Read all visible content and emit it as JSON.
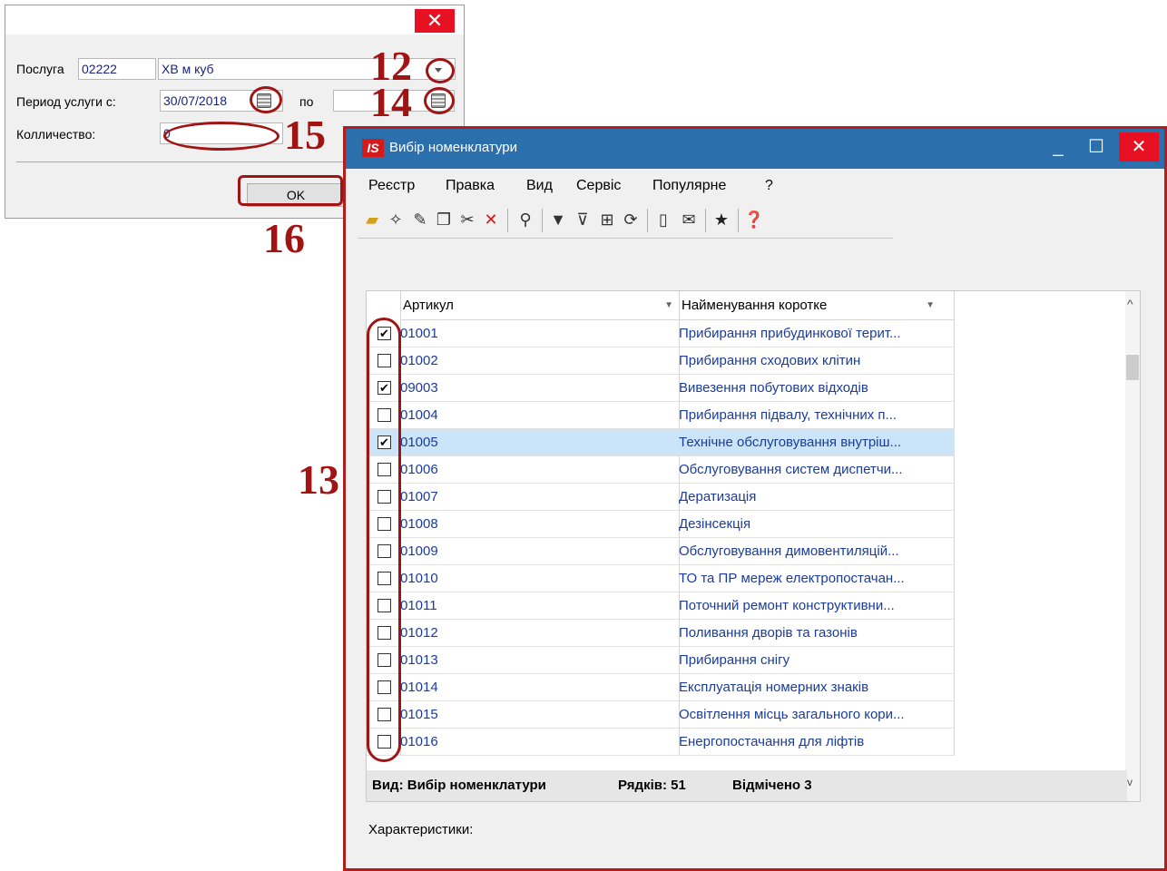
{
  "dialog": {
    "close_glyph": "✕",
    "service_label": "Послуга",
    "service_code": "02222",
    "service_name": "ХВ м куб",
    "period_label": "Период услуги с:",
    "period_from": "30/07/2018",
    "period_to_label": "по",
    "period_to": "",
    "quantity_label": "Колличество:",
    "quantity_value": "0",
    "ok_label": "OK"
  },
  "annotations": [
    "12",
    "14",
    "15",
    "16",
    "13"
  ],
  "window": {
    "logo": "IS",
    "title": "Вибір номенклатури",
    "minimize_glyph": "_",
    "maximize_glyph": "☐",
    "close_glyph": "✕",
    "menu": [
      "Реєстр",
      "Правка",
      "Вид",
      "Сервіс",
      "Популярне",
      "?"
    ],
    "grid": {
      "columns": [
        "Артикул",
        "Найменування коротке"
      ],
      "rows": [
        {
          "code": "01001",
          "name": "Прибирання прибудинкової терит...",
          "checked": true
        },
        {
          "code": "01002",
          "name": "Прибирання сходових клітин",
          "checked": false
        },
        {
          "code": "09003",
          "name": "Вивезення побутових відходів",
          "checked": true
        },
        {
          "code": "01004",
          "name": "Прибирання підвалу, технічних п...",
          "checked": false
        },
        {
          "code": "01005",
          "name": "Технічне обслуговування внутріш...",
          "checked": true,
          "selected": true
        },
        {
          "code": "01006",
          "name": "Обслуговування систем диспетчи...",
          "checked": false
        },
        {
          "code": "01007",
          "name": "Дератизація",
          "checked": false
        },
        {
          "code": "01008",
          "name": "Дезінсекція",
          "checked": false
        },
        {
          "code": "01009",
          "name": "Обслуговування димовентиляцій...",
          "checked": false
        },
        {
          "code": "01010",
          "name": "ТО та ПР мереж електропостачан...",
          "checked": false
        },
        {
          "code": "01011",
          "name": "Поточний ремонт конструктивни...",
          "checked": false
        },
        {
          "code": "01012",
          "name": "Поливання дворів та газонів",
          "checked": false
        },
        {
          "code": "01013",
          "name": "Прибирання снігу",
          "checked": false
        },
        {
          "code": "01014",
          "name": "Експлуатація номерних знаків",
          "checked": false
        },
        {
          "code": "01015",
          "name": "Освітлення місць загального кори...",
          "checked": false
        },
        {
          "code": "01016",
          "name": "Енергопостачання для ліфтів",
          "checked": false
        }
      ]
    },
    "status": {
      "view": "Вид: Вибір номенклатури",
      "rows": "Рядків: 51",
      "marked": "Відмічено 3"
    },
    "characteristics_label": "Характеристики:"
  },
  "colors": {
    "titlebar": "#2b6fad",
    "annotation": "#a01414",
    "close": "#e81123",
    "selected_row": "#cce4f7"
  }
}
